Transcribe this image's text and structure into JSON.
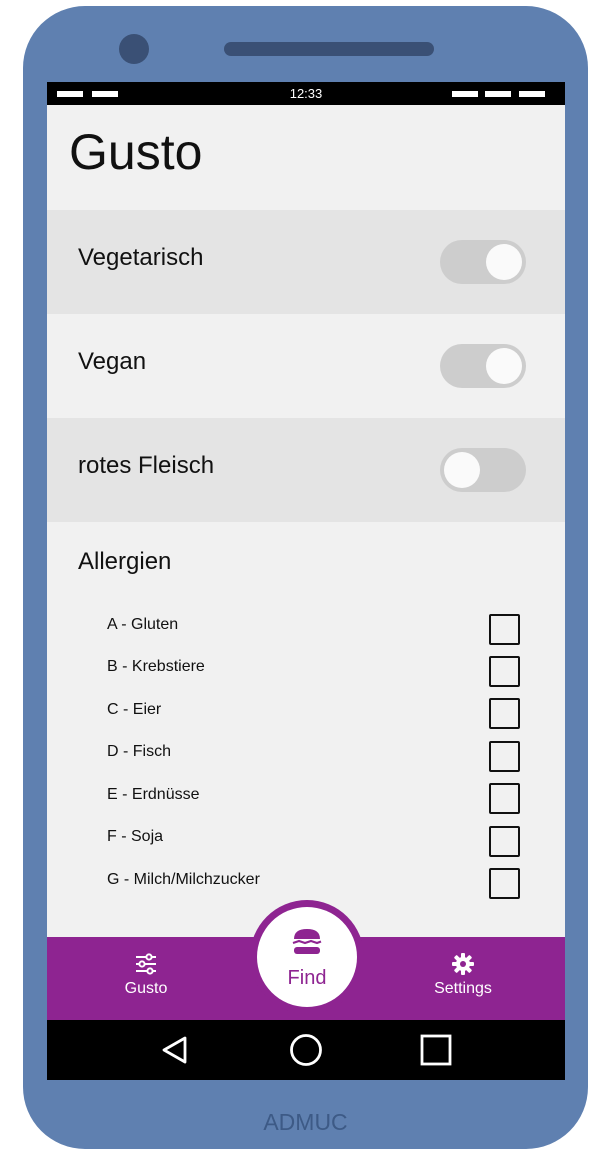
{
  "device": {
    "brand": "ADMUC"
  },
  "status_bar": {
    "time": "12:33"
  },
  "app": {
    "title": "Gusto"
  },
  "preferences": [
    {
      "label": "Vegetarisch",
      "enabled": true
    },
    {
      "label": "Vegan",
      "enabled": true
    },
    {
      "label": "rotes Fleisch",
      "enabled": false
    }
  ],
  "allergies": {
    "title": "Allergien",
    "items": [
      {
        "label": "A - Gluten",
        "checked": false
      },
      {
        "label": "B - Krebstiere",
        "checked": false
      },
      {
        "label": "C - Eier",
        "checked": false
      },
      {
        "label": "D - Fisch",
        "checked": false
      },
      {
        "label": "E - Erdnüsse",
        "checked": false
      },
      {
        "label": "F - Soja",
        "checked": false
      },
      {
        "label": "G - Milch/Milchzucker",
        "checked": false
      }
    ]
  },
  "bottom_nav": {
    "gusto": {
      "label": "Gusto",
      "icon": "sliders-icon"
    },
    "find": {
      "label": "Find",
      "icon": "burger-icon"
    },
    "settings": {
      "label": "Settings",
      "icon": "gear-icon"
    }
  },
  "colors": {
    "accent": "#8e2491",
    "phone_body": "#5f80b0",
    "screen_bg": "#f1f1f1"
  }
}
